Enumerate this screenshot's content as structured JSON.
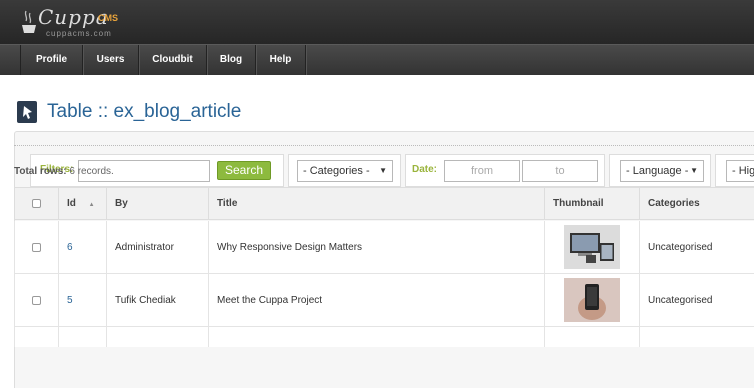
{
  "app": {
    "logo_name": "Cuppa",
    "logo_cms": "CMS",
    "logo_url": "cuppacms.com"
  },
  "nav": [
    {
      "label": "Profile"
    },
    {
      "label": "Users"
    },
    {
      "label": "Cloudbit"
    },
    {
      "label": "Blog"
    },
    {
      "label": "Help"
    }
  ],
  "page": {
    "title": "Table :: ex_blog_article"
  },
  "filters": {
    "label": "Filters:",
    "search_value": "",
    "search_button": "Search",
    "categories_select": "- Categories -",
    "date_label": "Date:",
    "from_placeholder": "from",
    "to_placeholder": "to",
    "language_select": "- Language -",
    "highlight_select": "- Hig"
  },
  "summary": {
    "label": "Total rows:",
    "value": "6 records."
  },
  "table": {
    "columns": [
      "Id",
      "By",
      "Title",
      "Thumbnail",
      "Categories"
    ],
    "rows": [
      {
        "id": "6",
        "by": "Administrator",
        "title": "Why Responsive Design Matters",
        "category": "Uncategorised",
        "thumb_icon": "devices-thumbnail-icon"
      },
      {
        "id": "5",
        "by": "Tufik Chediak",
        "title": "Meet the Cuppa Project",
        "category": "Uncategorised",
        "thumb_icon": "phone-in-hand-thumbnail-icon"
      }
    ]
  },
  "colors": {
    "accent_green": "#8dba3e",
    "filter_label": "#9ab43c",
    "title_blue": "#2a6496"
  }
}
